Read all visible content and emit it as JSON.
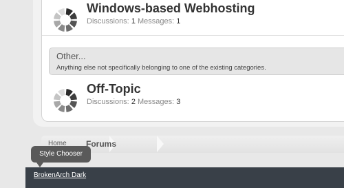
{
  "forums": [
    {
      "title": "Windows-based Webhosting",
      "discussions_label": "Discussions:",
      "discussions": "1",
      "messages_label": "Messages:",
      "messages": "1"
    },
    {
      "title": "Off-Topic",
      "discussions_label": "Discussions:",
      "discussions": "2",
      "messages_label": "Messages:",
      "messages": "3"
    }
  ],
  "category": {
    "title": "Other...",
    "description": "Anything else not specifically belonging to one of the existing categories."
  },
  "breadcrumb": {
    "home": "Home",
    "current": "Forums"
  },
  "tooltip": "Style Chooser",
  "footer": {
    "style_link": "BrokenArch Dark"
  },
  "colors": {
    "footer_bg": "#394048",
    "tooltip_bg": "#5a5a5a"
  }
}
